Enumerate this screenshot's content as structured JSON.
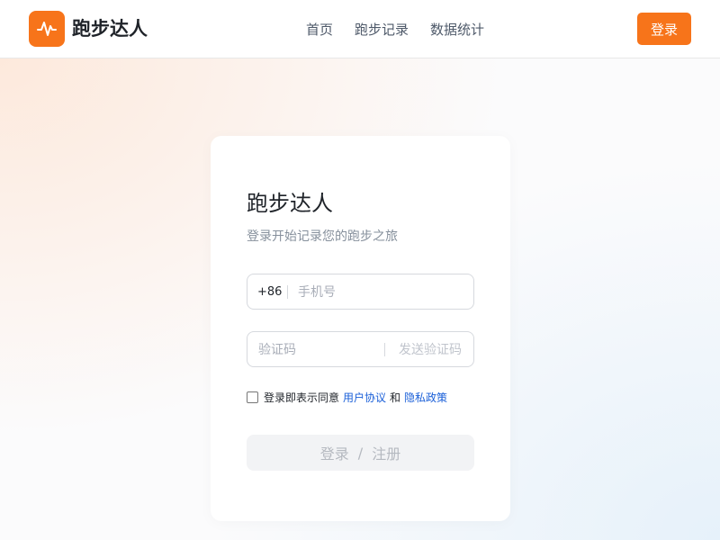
{
  "app": {
    "name": "跑步达人",
    "brand_color": "#f7741a",
    "logo_icon": "pulse-icon"
  },
  "header": {
    "nav": [
      {
        "label": "首页"
      },
      {
        "label": "跑步记录"
      },
      {
        "label": "数据统计"
      }
    ],
    "login_button": "登录"
  },
  "login_card": {
    "title": "跑步达人",
    "subtitle": "登录开始记录您的跑步之旅",
    "phone": {
      "country_code": "+86",
      "placeholder": "手机号",
      "value": ""
    },
    "code": {
      "placeholder": "验证码",
      "value": "",
      "send_label": "发送验证码"
    },
    "agreement": {
      "checked": false,
      "prefix": "登录即表示同意",
      "terms_link": "用户协议",
      "and": "和",
      "privacy_link": "隐私政策"
    },
    "submit": {
      "login": "登录",
      "separator": "/",
      "register": "注册"
    }
  }
}
